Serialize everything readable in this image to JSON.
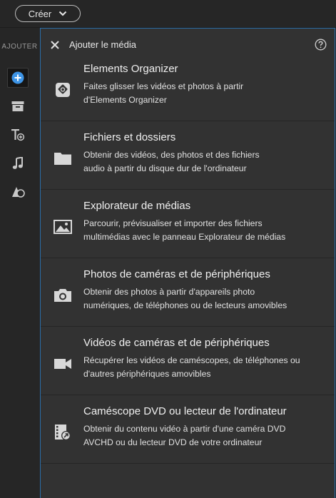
{
  "topbar": {
    "create_label": "Créer"
  },
  "rail": {
    "title": "AJOUTER",
    "icons": [
      "add-media-icon",
      "archive-icon",
      "text-add-icon",
      "music-icon",
      "graphics-icon"
    ]
  },
  "panel": {
    "title": "Ajouter le média",
    "items": [
      {
        "title": "Elements Organizer",
        "desc1": "Faites glisser les vidéos et photos à partir",
        "desc2": "d'Elements Organizer",
        "icon": "organizer-icon"
      },
      {
        "title": "Fichiers et dossiers",
        "desc1": "Obtenir des vidéos, des photos et des fichiers",
        "desc2": "audio à partir du disque dur de l'ordinateur",
        "icon": "folder-icon"
      },
      {
        "title": "Explorateur de médias",
        "desc1": "Parcourir, prévisualiser et importer des fichiers",
        "desc2": "multimédias avec le panneau Explorateur de médias",
        "icon": "image-icon"
      },
      {
        "title": "Photos de caméras et de périphériques",
        "desc1": "Obtenir des photos à partir d'appareils photo",
        "desc2": "numériques, de téléphones ou de lecteurs amovibles",
        "icon": "camera-icon"
      },
      {
        "title": "Vidéos de caméras et de périphériques",
        "desc1": "Récupérer les vidéos de caméscopes, de téléphones ou",
        "desc2": "d'autres périphériques amovibles",
        "icon": "video-camera-icon"
      },
      {
        "title": "Caméscope DVD ou lecteur de l'ordinateur",
        "desc1": "Obtenir du contenu vidéo à partir d'une caméra DVD",
        "desc2": "AVCHD ou du lecteur DVD de votre ordinateur",
        "icon": "dvd-camcorder-icon"
      }
    ]
  },
  "colors": {
    "accent": "#2b6ea8",
    "active_icon": "#3d94e6",
    "panel_bg": "#323232",
    "rail_bg": "#262626"
  }
}
